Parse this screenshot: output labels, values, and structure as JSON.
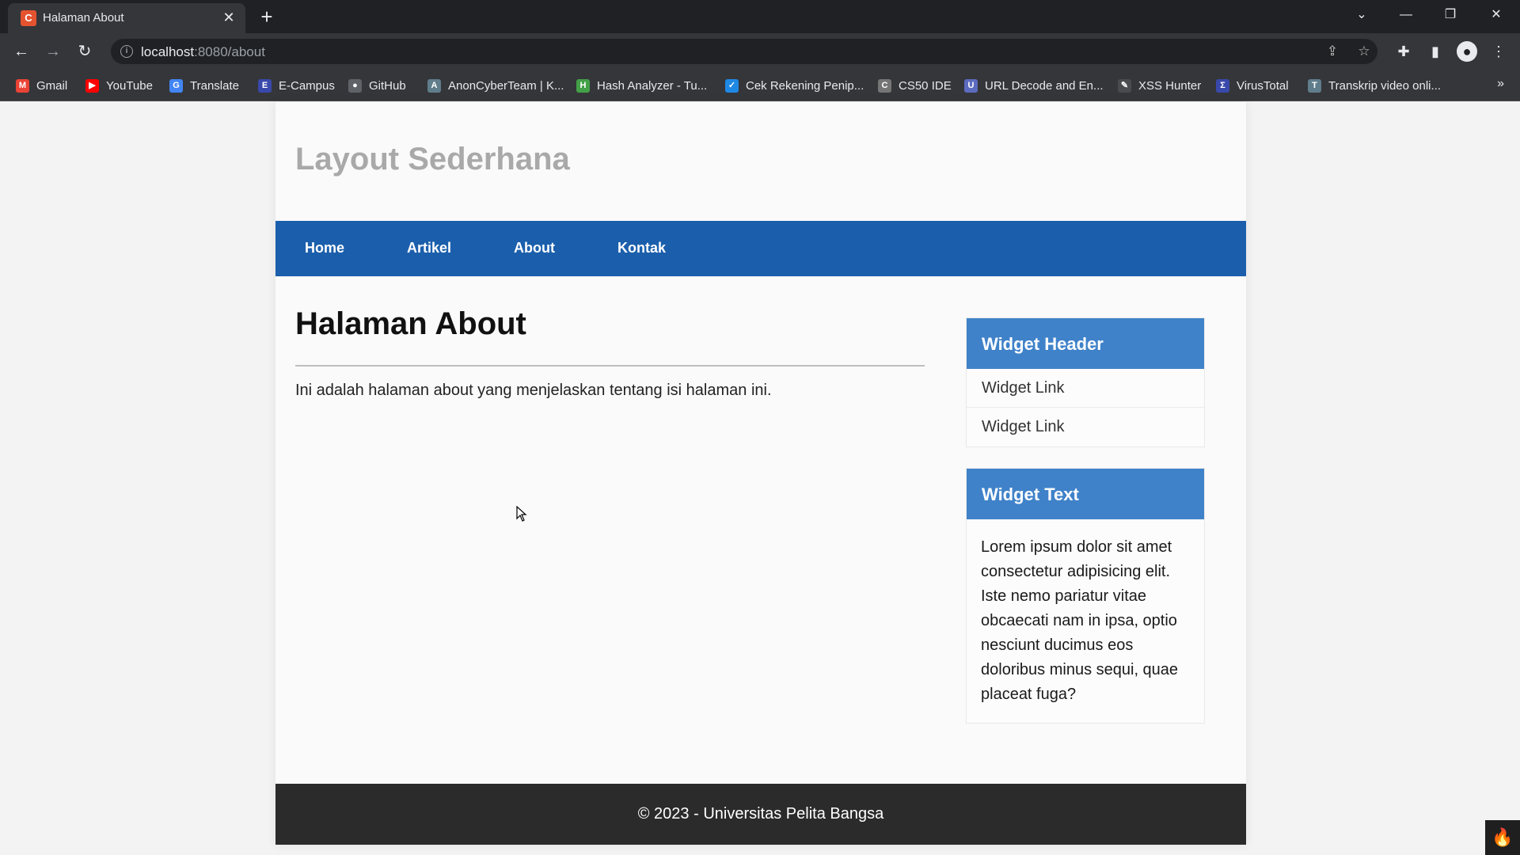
{
  "browser": {
    "tab_title": "Halaman About",
    "tab_close": "✕",
    "new_tab": "+",
    "url_host": "localhost",
    "url_rest": ":8080/about",
    "bookmarks": [
      {
        "label": "Gmail",
        "icon": "gmail-icon",
        "glyph": "M",
        "color": "#ea4335"
      },
      {
        "label": "YouTube",
        "icon": "youtube-icon",
        "glyph": "▶",
        "color": "#ff0000"
      },
      {
        "label": "Translate",
        "icon": "translate-icon",
        "glyph": "G",
        "color": "#4285f4"
      },
      {
        "label": "E-Campus",
        "icon": "ecampus-icon",
        "glyph": "E",
        "color": "#3949ab"
      },
      {
        "label": "GitHub",
        "icon": "github-icon",
        "glyph": "●",
        "color": "#5f6368"
      },
      {
        "label": "AnonCyberTeam | K...",
        "icon": "anoncyberteam-icon",
        "glyph": "A",
        "color": "#607d8b"
      },
      {
        "label": "Hash Analyzer - Tu...",
        "icon": "hash-analyzer-icon",
        "glyph": "H",
        "color": "#43a047"
      },
      {
        "label": "Cek Rekening Penip...",
        "icon": "check-badge-icon",
        "glyph": "✓",
        "color": "#1e88e5"
      },
      {
        "label": "CS50 IDE",
        "icon": "cs50-icon",
        "glyph": "C",
        "color": "#757575"
      },
      {
        "label": "URL Decode and En...",
        "icon": "url-decode-icon",
        "glyph": "U",
        "color": "#5c6bc0"
      },
      {
        "label": "XSS Hunter",
        "icon": "xss-hunter-icon",
        "glyph": "✎",
        "color": "#4a4b4f"
      },
      {
        "label": "VirusTotal",
        "icon": "virustotal-icon",
        "glyph": "Σ",
        "color": "#3949ab"
      },
      {
        "label": "Transkrip video onli...",
        "icon": "transcript-icon",
        "glyph": "T",
        "color": "#607d8b"
      }
    ],
    "bookmarks_more": "»"
  },
  "page": {
    "site_title": "Layout Sederhana",
    "nav": [
      "Home",
      "Artikel",
      "About",
      "Kontak"
    ],
    "heading": "Halaman About",
    "text": "Ini adalah halaman about yang menjelaskan tentang isi halaman ini.",
    "widget_links": {
      "header": "Widget Header",
      "links": [
        "Widget Link",
        "Widget Link"
      ]
    },
    "widget_text": {
      "header": "Widget Text",
      "body": "Lorem ipsum dolor sit amet consectetur adipisicing elit. Iste nemo pariatur vitae obcaecati nam in ipsa, optio nesciunt ducimus eos doloribus minus sequi, quae placeat fuga?"
    },
    "footer": "© 2023 - Universitas Pelita Bangsa"
  },
  "colors": {
    "navbar": "#1b5fac",
    "widget_header": "#3f82c9",
    "footer": "#2b2b2b",
    "site_title": "#a9a9a9"
  }
}
